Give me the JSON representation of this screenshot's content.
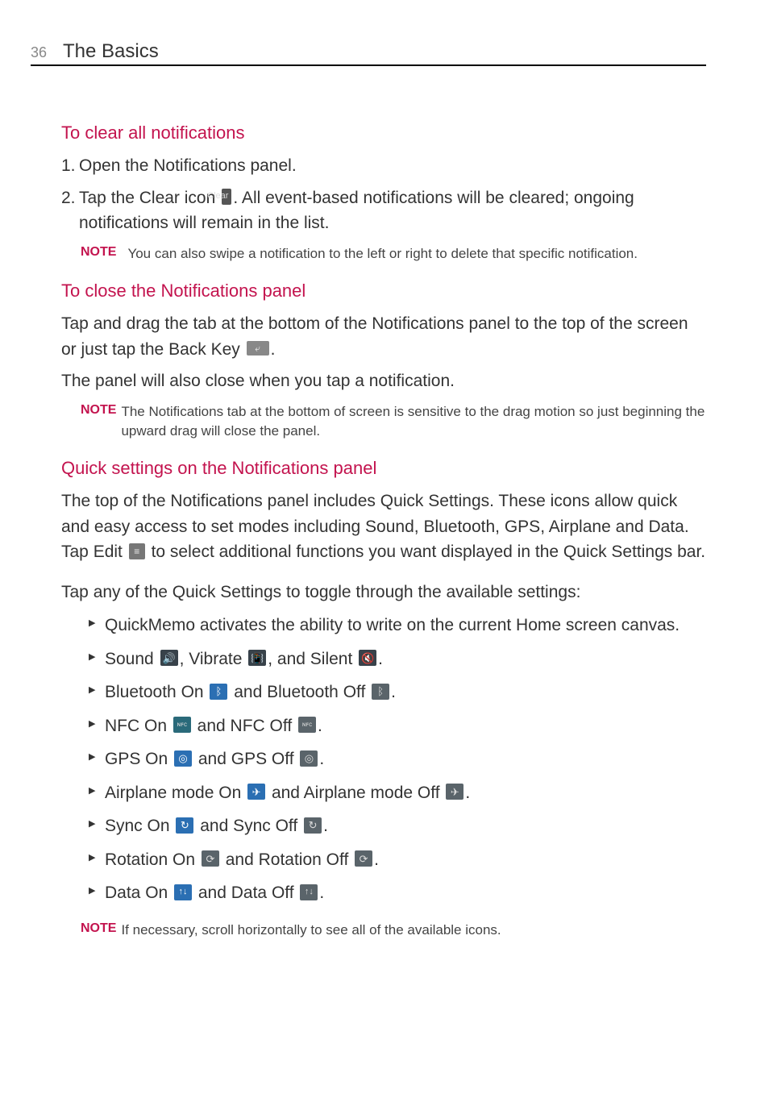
{
  "header": {
    "page_number": "36",
    "chapter_title": "The Basics"
  },
  "sections": {
    "clear": {
      "heading": "To clear all notifications",
      "step1": "Open the Notifications panel.",
      "step2_a": "Tap the ",
      "step2_b_bold": "Clear",
      "step2_c": " icon ",
      "step2_d": ". All event-based notifications will be cleared; ongoing notifications will remain in the list.",
      "note_label": "NOTE",
      "note_text": "You can also swipe a notification to the left or right to delete that specific notification."
    },
    "close": {
      "heading": "To close the Notifications panel",
      "p1_a": "Tap and drag the tab at the bottom of the Notifications panel to the top of the screen or just tap the ",
      "p1_b_bold": "Back Key",
      "p1_c": " ",
      "p1_d": ".",
      "p2": "The panel will also close when you tap a notification.",
      "note_label": "NOTE",
      "note_text": "The Notifications tab at the bottom of screen is sensitive to the drag motion so just beginning the upward drag will close the panel."
    },
    "quick": {
      "heading": "Quick settings on the Notifications panel",
      "p1_a": "The top of the Notifications panel includes Quick Settings. These icons allow quick and easy access to set modes including Sound, Bluetooth, GPS, Airplane and Data. Tap ",
      "p1_b_bold": "Edit",
      "p1_c": " ",
      "p1_d": " to select additional functions you want displayed in the Quick Settings bar.",
      "p2": "Tap any of the Quick Settings to toggle through the available settings:",
      "bullets": {
        "b1": "QuickMemo activates the ability to write on the current Home screen canvas.",
        "b2_a": "Sound ",
        "b2_b": ", Vibrate ",
        "b2_c": ", and Silent ",
        "b2_d": ".",
        "b3_a": "Bluetooth On ",
        "b3_b": " and Bluetooth Off ",
        "b3_c": ".",
        "b4_a": "NFC On ",
        "b4_b": " and NFC Off ",
        "b4_c": ".",
        "b5_a": "GPS On ",
        "b5_b": " and GPS Off ",
        "b5_c": ".",
        "b6_a": "Airplane mode On ",
        "b6_b": " and Airplane mode Off ",
        "b6_c": ".",
        "b7_a": "Sync On ",
        "b7_b": " and Sync Off ",
        "b7_c": ".",
        "b8_a": "Rotation On ",
        "b8_b": " and Rotation Off ",
        "b8_c": ".",
        "b9_a": "Data On ",
        "b9_b": " and Data Off ",
        "b9_c": "."
      },
      "note_label": "NOTE",
      "note_text": "If necessary, scroll horizontally to see all of the available icons."
    }
  },
  "icons": {
    "clear_label": "Clear",
    "back_glyph": "⤶",
    "edit_glyph": "≡",
    "sound": "🔊",
    "vibrate": "📳",
    "silent": "🔇",
    "bt_on": "ᛒ",
    "bt_off": "ᛒ",
    "nfc_on": "ɴꜰᴄ",
    "nfc_off": "ɴꜰᴄ",
    "gps_on": "◎",
    "gps_off": "◎",
    "air_on": "✈",
    "air_off": "✈",
    "sync_on": "↻",
    "sync_off": "↻",
    "rot_on": "⟳",
    "rot_off": "⟳",
    "data_on": "↑↓",
    "data_off": "↑↓"
  }
}
